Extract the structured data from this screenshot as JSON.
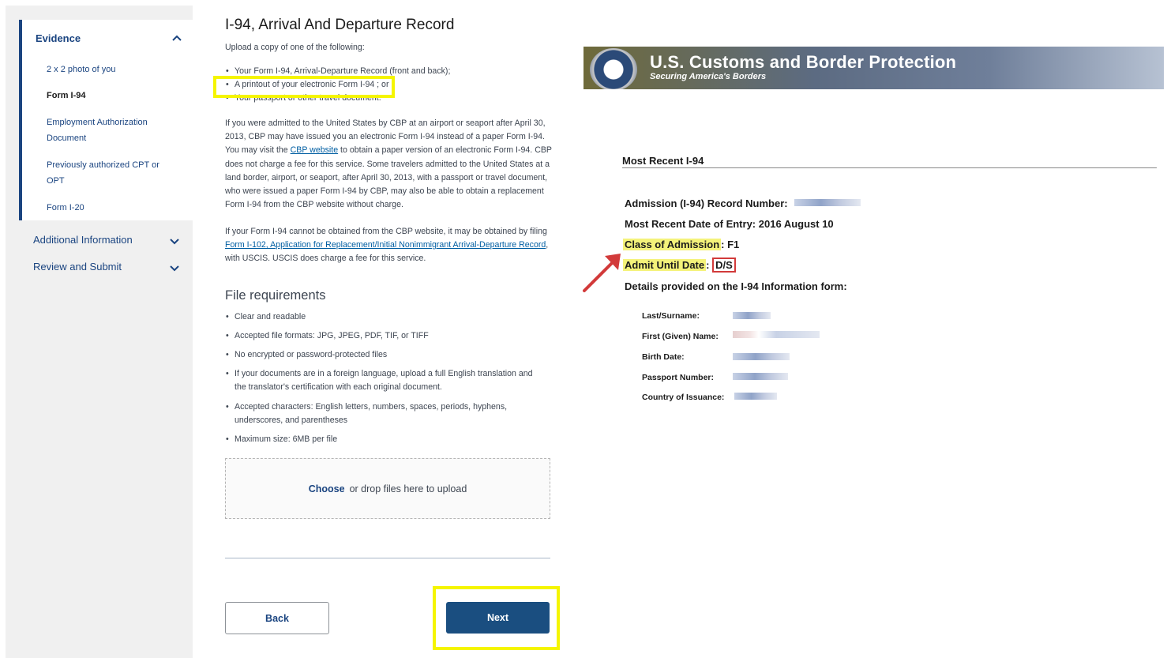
{
  "sidebar": {
    "evidence_heading": "Evidence",
    "items": [
      {
        "label": "2 x 2 photo of you",
        "active": false
      },
      {
        "label": "Form I-94",
        "active": true
      },
      {
        "label": "Employment Authorization Document",
        "active": false
      },
      {
        "label": "Previously authorized CPT or OPT",
        "active": false
      },
      {
        "label": "Form I-20",
        "active": false
      }
    ],
    "sections": [
      "Additional Information",
      "Review and Submit"
    ]
  },
  "form": {
    "title": "I-94, Arrival And Departure Record",
    "intro": "Upload a copy of one of the following:",
    "options": [
      "Your Form I-94, Arrival-Departure Record (front and back);",
      "A printout of your electronic Form I-94 ; or",
      "Your passport or other travel document."
    ],
    "para1_a": "If you were admitted to the United States by CBP at an airport or seaport after April 30, 2013, CBP may have issued you an electronic Form I-94 instead of a paper Form I-94. You may visit the ",
    "para1_link": "CBP website",
    "para1_b": " to obtain a paper version of an electronic Form I-94. CBP does not charge a fee for this service. Some travelers admitted to the United States at a land border, airport, or seaport, after April 30, 2013, with a passport or travel document, who were issued a paper Form I-94 by CBP, may also be able to obtain a replacement Form I-94 from the CBP website without charge.",
    "para2_a": "If your Form I-94 cannot be obtained from the CBP website, it may be obtained by filing ",
    "para2_link": "Form I-102, Application for Replacement/Initial Nonimmigrant Arrival-Departure Record",
    "para2_b": ", with USCIS. USCIS does charge a fee for this service.",
    "file_req_heading": "File requirements",
    "file_reqs": [
      "Clear and readable",
      "Accepted file formats: JPG, JPEG, PDF, TIF, or TIFF",
      "No encrypted or password-protected files",
      "If your documents are in a foreign language, upload a full English translation and the translator's certification with each original document.",
      "Accepted characters: English letters, numbers, spaces, periods, hyphens, underscores, and parentheses",
      "Maximum size: 6MB per file"
    ],
    "dropzone_choose": "Choose",
    "dropzone_text": "or drop files here to upload",
    "back_label": "Back",
    "next_label": "Next"
  },
  "cbp": {
    "banner_title": "U.S. Customs and Border Protection",
    "banner_subtitle": "Securing America's Borders",
    "section_heading": "Most Recent I-94",
    "record_number_label": "Admission (I-94) Record Number:",
    "entry_date_label": "Most Recent Date of Entry:",
    "entry_date_value": "2016 August 10",
    "class_label": "Class of Admission",
    "class_value": "F1",
    "admit_label": "Admit Until Date",
    "admit_value": "D/S",
    "details_heading": "Details provided on the I-94 Information form:",
    "details_labels": [
      "Last/Surname:",
      "First (Given) Name:",
      "Birth Date:",
      "Passport Number:",
      "Country of Issuance:"
    ]
  },
  "colors": {
    "accent": "#1a4480",
    "highlight": "#f5f500",
    "annotation_red": "#d23a3a"
  }
}
